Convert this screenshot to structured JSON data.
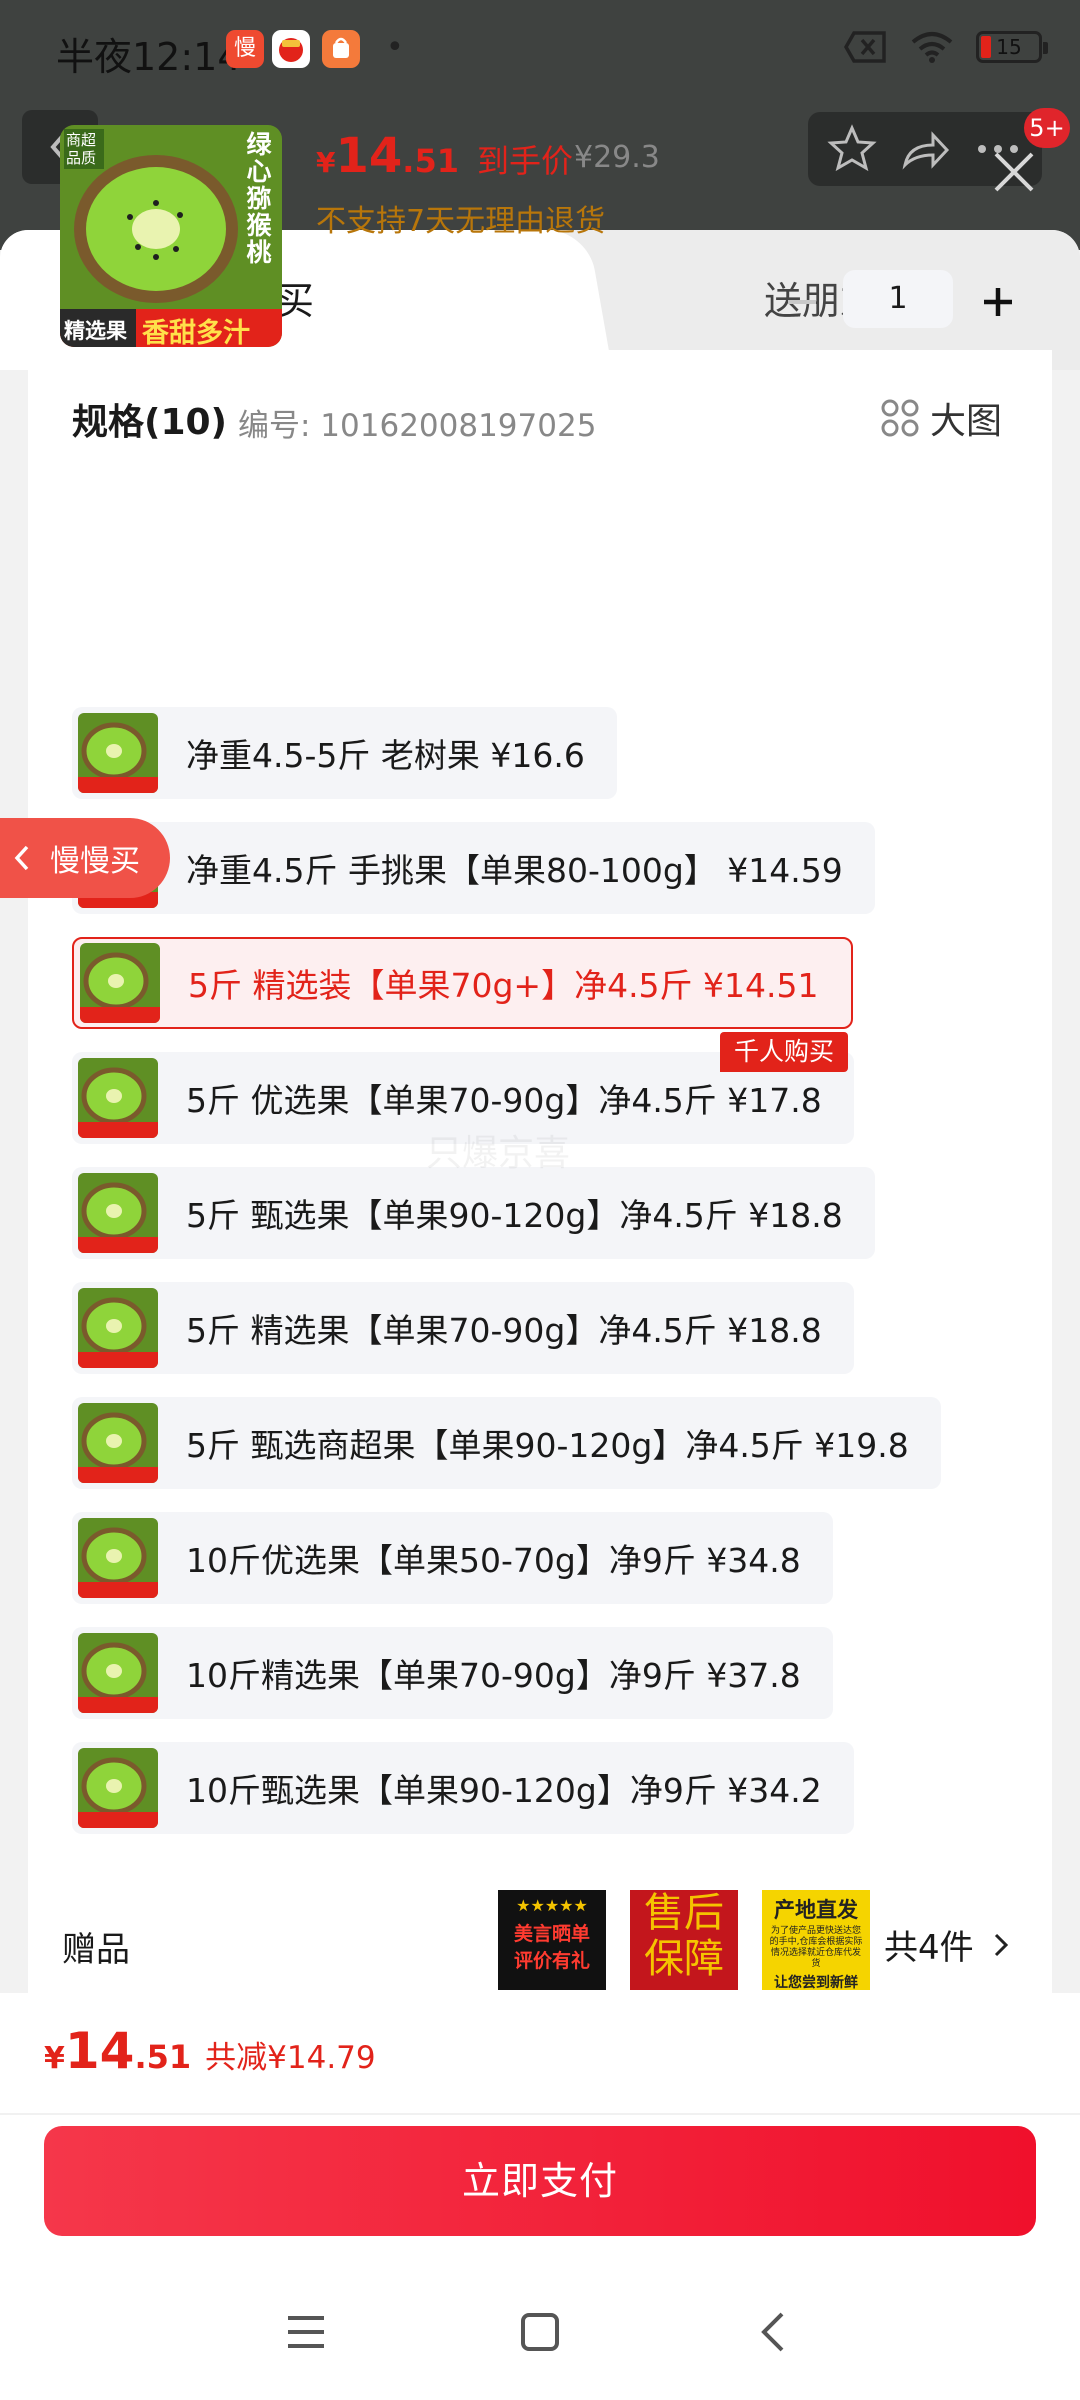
{
  "status_bar": {
    "time": "半夜12:14",
    "app_icons": [
      {
        "name": "slow-buy-app-icon",
        "text": "慢",
        "color": "#ef4a30"
      },
      {
        "name": "shopping-app-icon",
        "text": "",
        "color": "#ffffff"
      },
      {
        "name": "shopping-bag-app-icon",
        "text": "",
        "color": "#f47a3b"
      }
    ],
    "dot": "•",
    "battery_level": "15"
  },
  "background_page": {
    "notification_badge": "5+"
  },
  "tabs": {
    "self_buy": "自己买",
    "gift_friend": "送朋友"
  },
  "product": {
    "price_symbol": "¥",
    "price_integer": "14",
    "price_decimal": ".51",
    "price_label": "到手价",
    "original_price": "¥29.3",
    "return_policy": "不支持7天无理由退货",
    "quantity": "1",
    "image_texts": {
      "corner": "商超品质",
      "vertical": "绿心猕猴桃",
      "tag_left": "精选果",
      "tag_right": "香甜多汁"
    }
  },
  "spec": {
    "title": "规格(10)",
    "code": "编号: 10162008197025",
    "big_image_label": "大图",
    "options": [
      {
        "label": "净重4.5-5斤 老树果  ¥16.6",
        "selected": false
      },
      {
        "label": "净重4.5斤 手挑果【单果80-100g】  ¥14.59",
        "selected": false
      },
      {
        "label": "5斤 精选装【单果70g+】净4.5斤  ¥14.51",
        "selected": true
      },
      {
        "label": "5斤 优选果【单果70-90g】净4.5斤  ¥17.8",
        "selected": false
      },
      {
        "label": "5斤 甄选果【单果90-120g】净4.5斤  ¥18.8",
        "selected": false
      },
      {
        "label": "5斤 精选果【单果70-90g】净4.5斤  ¥18.8",
        "selected": false
      },
      {
        "label": "5斤 甄选商超果【单果90-120g】净4.5斤  ¥19.8",
        "selected": false
      },
      {
        "label": "10斤优选果【单果50-70g】净9斤  ¥34.8",
        "selected": false
      },
      {
        "label": "10斤精选果【单果70-90g】净9斤  ¥37.8",
        "selected": false
      },
      {
        "label": "10斤甄选果【单果90-120g】净9斤  ¥34.2",
        "selected": false
      }
    ],
    "hot_badge": "千人购买"
  },
  "floating_tab": {
    "label": "慢慢买"
  },
  "watermark": "只爆京喜",
  "gifts": {
    "label": "赠品",
    "items": [
      {
        "line1": "★★★★★",
        "line2": "美言晒单",
        "line3": "评价有礼"
      },
      {
        "line1": "售后",
        "line2": "保障"
      },
      {
        "line1": "产地直发",
        "line2": "为了使产品更快送达您的手中,仓库会根据实际情况选择就近仓库代发货",
        "line3": "让您尝到新鲜"
      }
    ],
    "count": "共4件"
  },
  "footer": {
    "price_symbol": "¥",
    "price_integer": "14",
    "price_decimal": ".51",
    "reduction": "共减¥14.79",
    "pay_button": "立即支付"
  },
  "colors": {
    "accent_red": "#e2231a",
    "return_policy": "#b8760a",
    "pay_gradient_start": "#f5374a",
    "pay_gradient_end": "#f0102c"
  }
}
